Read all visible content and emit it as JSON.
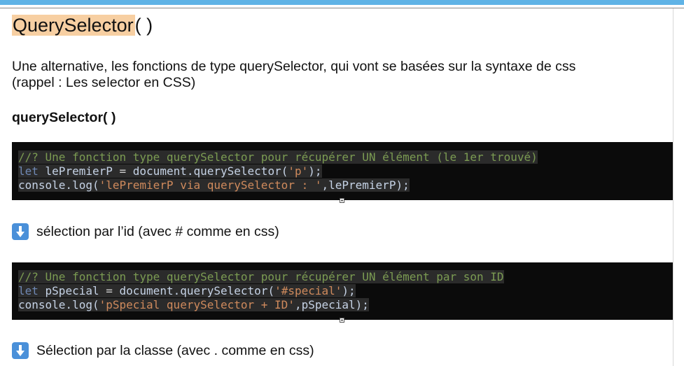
{
  "heading": {
    "highlighted": "QuerySelector",
    "rest": "( )"
  },
  "intro": {
    "line1": "Une alternative, les fonctions de type querySelector, qui vont se basées sur la syntaxe de css",
    "line2_a": "(rappel : Les se",
    "line2_b": "lector en CSS)"
  },
  "subheading": "querySelector( )",
  "code1": {
    "l1": "//? Une fonction type querySelector pour récupérer UN élément (le 1er trouvé)",
    "l2_kw": "let",
    "l2_var": " lePremierP",
    "l2_eq": " = ",
    "l2_obj": "document.querySelector(",
    "l2_str": "'p'",
    "l2_end": ");",
    "l3_call": "console.log(",
    "l3_str": "'lePremierP via querySelector : '",
    "l3_arg": ",lePremierP",
    "l3_end": ");"
  },
  "arrow1": "sélection par l’id (avec # comme en css)",
  "code2": {
    "l1": "//? Une fonction type querySelector pour récupérer UN élément par son ID",
    "l2_kw": "let",
    "l2_var": " pSpecial",
    "l2_eq": " = ",
    "l2_obj": "document.querySelector(",
    "l2_str": "'#special'",
    "l2_end": ");",
    "l3_call": "console.log(",
    "l3_str": "'pSpecial querySelector + ID'",
    "l3_arg": ",pSpecial",
    "l3_end": ");"
  },
  "arrow2": "Sélection par la classe (avec . comme en css)",
  "colors": {
    "top_bar": "#5fb3e6",
    "highlight": "#f7cfa2",
    "code_bg": "#0b0b0b",
    "arrow_icon": "#4a90d9"
  }
}
